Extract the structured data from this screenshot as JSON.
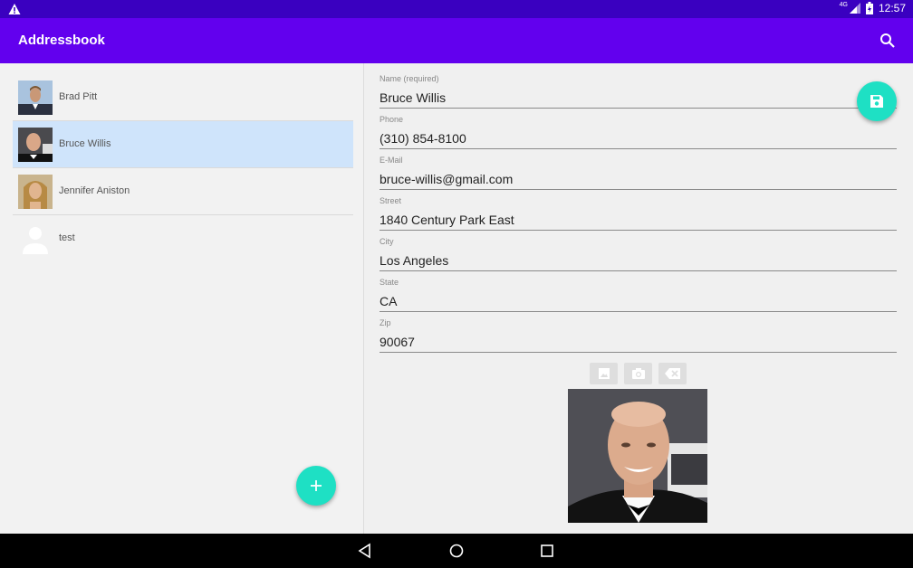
{
  "status_bar": {
    "network": "4G",
    "time": "12:57",
    "icons": [
      "warning-icon",
      "signal-icon",
      "battery-icon"
    ]
  },
  "app_bar": {
    "title": "Addressbook",
    "search_icon": "search-icon"
  },
  "contacts": [
    {
      "name": "Brad Pitt",
      "selected": false,
      "thumb": "photo"
    },
    {
      "name": "Bruce Willis",
      "selected": true,
      "thumb": "photo"
    },
    {
      "name": "Jennifer Aniston",
      "selected": false,
      "thumb": "photo"
    },
    {
      "name": "test",
      "selected": false,
      "thumb": "person-placeholder-icon"
    }
  ],
  "detail": {
    "fields": [
      {
        "label": "Name (required)",
        "value": "Bruce Willis"
      },
      {
        "label": "Phone",
        "value": "(310) 854-8100"
      },
      {
        "label": "E-Mail",
        "value": "bruce-willis@gmail.com"
      },
      {
        "label": "Street",
        "value": "1840 Century Park East"
      },
      {
        "label": "City",
        "value": "Los Angeles"
      },
      {
        "label": "State",
        "value": "CA"
      },
      {
        "label": "Zip",
        "value": "90067"
      }
    ],
    "image_buttons": [
      "gallery-icon",
      "camera-icon",
      "backspace-clear-icon"
    ]
  },
  "colors": {
    "status_bar": "#3a00c0",
    "app_bar": "#6200ee",
    "fab": "#1ee0c4",
    "selected_row": "#cfe4fb"
  },
  "nav_bar": {
    "icons": [
      "back-icon",
      "home-icon",
      "recents-icon"
    ]
  }
}
